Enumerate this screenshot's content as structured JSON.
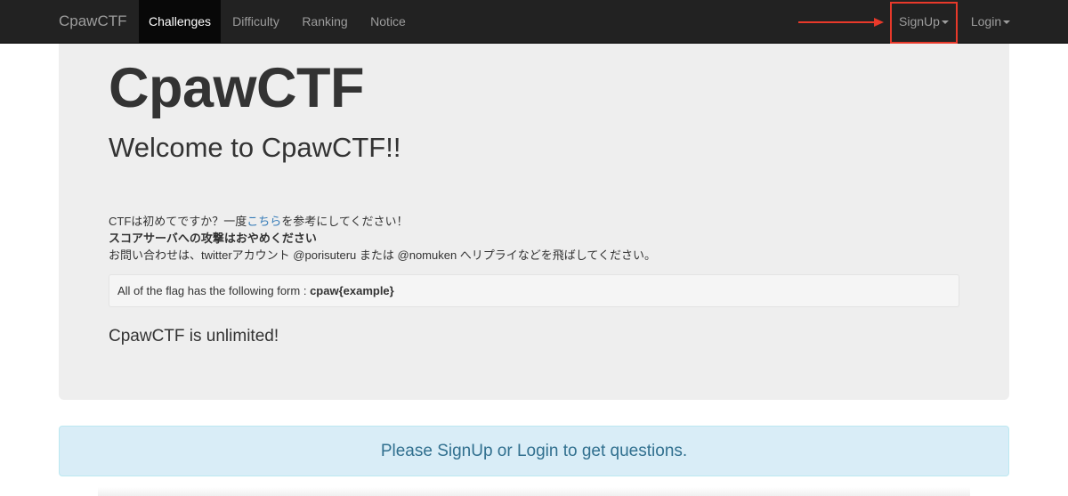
{
  "navbar": {
    "brand": "CpawCTF",
    "items": [
      {
        "label": "Challenges",
        "active": true
      },
      {
        "label": "Difficulty",
        "active": false
      },
      {
        "label": "Ranking",
        "active": false
      },
      {
        "label": "Notice",
        "active": false
      }
    ],
    "right_items": [
      {
        "label": "SignUp"
      },
      {
        "label": "Login"
      }
    ],
    "highlight_color": "#e8392a"
  },
  "jumbotron": {
    "title": "CpawCTF",
    "subtitle": "Welcome to CpawCTF!!",
    "line1_prefix": "CTFは初めてですか？一度",
    "line1_link": "こちら",
    "line1_suffix": "を参考にしてください！",
    "line2": "スコアサーバへの攻撃はおやめください",
    "line3": "お問い合わせは、twitterアカウント @porisuteru または @nomuken へリプライなどを飛ばしてください。",
    "flag_prefix": "All of the flag has the following form : ",
    "flag_format": "cpaw{example}",
    "unlimited": "CpawCTF is unlimited!"
  },
  "alert": {
    "text": "Please SignUp or Login to get questions."
  }
}
